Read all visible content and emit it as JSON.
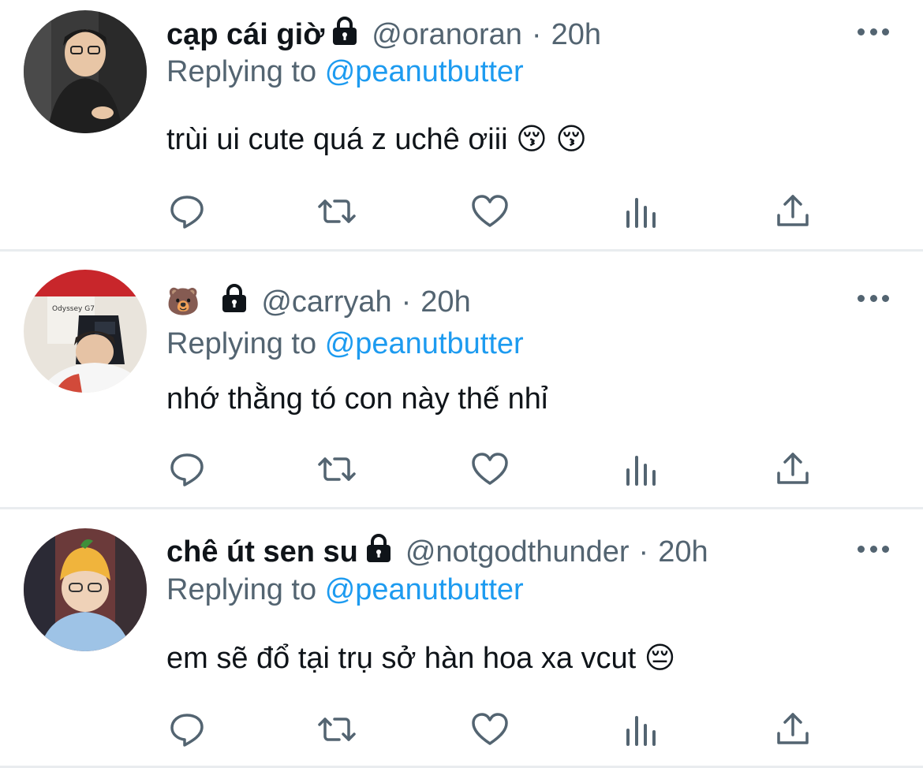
{
  "tweets": [
    {
      "display_name": "cạp cái giờ",
      "handle": "@oranoran",
      "separator": "·",
      "time": "20h",
      "replying_prefix": "Replying to",
      "replying_handle": "@peanutbutter",
      "text": "trùi ui cute quá z uchê ơiii 😚 😚",
      "protected": true,
      "avatar_icon": "user-photo"
    },
    {
      "display_name": "🐻",
      "handle": "@carryah",
      "separator": "·",
      "time": "20h",
      "replying_prefix": "Replying to",
      "replying_handle": "@peanutbutter",
      "text": "nhớ thằng tó con này thế nhỉ",
      "protected": true,
      "avatar_icon": "user-photo"
    },
    {
      "display_name": "chê út sen su",
      "handle": "@notgodthunder",
      "separator": "·",
      "time": "20h",
      "replying_prefix": "Replying to",
      "replying_handle": "@peanutbutter",
      "text": "em sẽ đổ tại trụ sở hàn hoa xa vcut 😔",
      "protected": true,
      "avatar_icon": "user-photo"
    }
  ],
  "action_icons": [
    "reply-icon",
    "retweet-icon",
    "like-icon",
    "analytics-icon",
    "share-icon"
  ],
  "colors": {
    "text": "#0f1419",
    "secondary": "#536471",
    "link": "#1d9bf0",
    "divider": "#e9ecef"
  }
}
